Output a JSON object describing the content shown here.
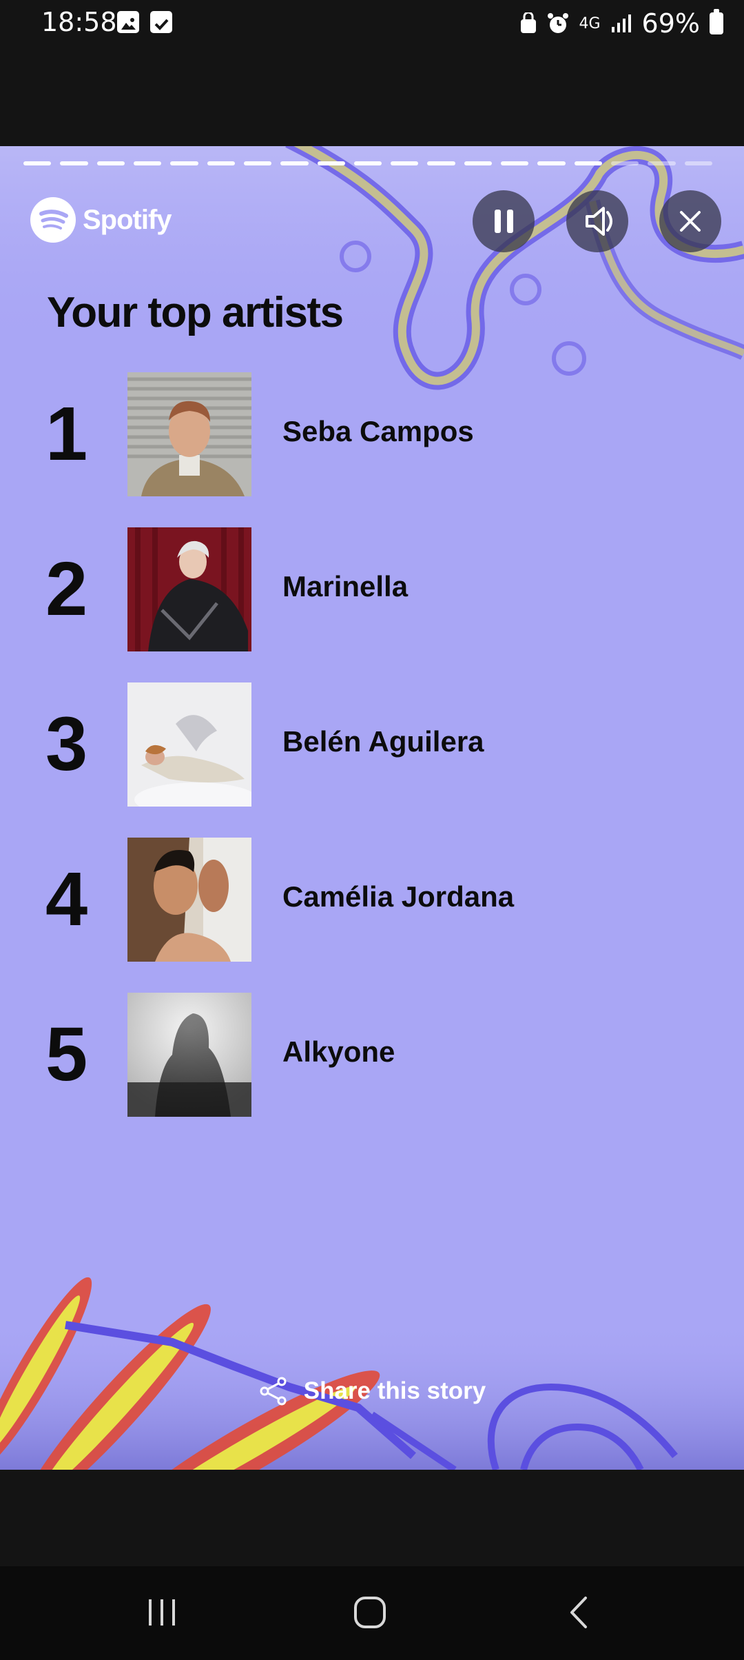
{
  "status_bar": {
    "time": "18:58",
    "network": "4G",
    "battery": "69%"
  },
  "story": {
    "brand": "Spotify",
    "progress": {
      "segments": 19,
      "completed": 16
    },
    "title": "Your top artists",
    "share_label": "Share this story",
    "background_color": "#a9a6f5",
    "artists": [
      {
        "rank": "1",
        "name": "Seba Campos",
        "art": "portrait-man-striped-wall"
      },
      {
        "rank": "2",
        "name": "Marinella",
        "art": "woman-red-curtain"
      },
      {
        "rank": "3",
        "name": "Belén Aguilera",
        "art": "woman-lying-white-fabric"
      },
      {
        "rank": "4",
        "name": "Camélia Jordana",
        "art": "woman-profile-split"
      },
      {
        "rank": "5",
        "name": "Alkyone",
        "art": "blurred-silhouette-grey"
      }
    ]
  },
  "icons": {
    "pause": "pause-icon",
    "mute": "speaker-muted-icon",
    "close": "close-icon",
    "share": "share-icon",
    "nav_recents": "recents-icon",
    "nav_home": "home-icon",
    "nav_back": "back-icon"
  }
}
